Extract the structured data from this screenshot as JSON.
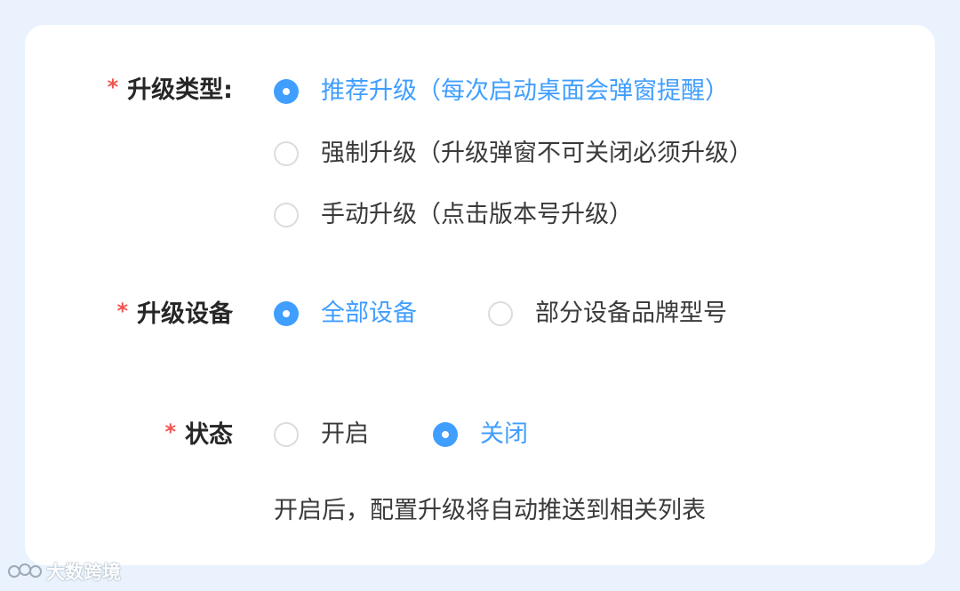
{
  "form": {
    "upgrade_type": {
      "required_mark": "*",
      "label": "升级类型:",
      "options": [
        {
          "text": "推荐升级（每次启动桌面会弹窗提醒）",
          "checked": true
        },
        {
          "text": "强制升级（升级弹窗不可关闭必须升级）",
          "checked": false
        },
        {
          "text": "手动升级（点击版本号升级）",
          "checked": false
        }
      ]
    },
    "upgrade_devices": {
      "required_mark": "*",
      "label": "升级设备",
      "options": [
        {
          "text": "全部设备",
          "checked": true
        },
        {
          "text": "部分设备品牌型号",
          "checked": false
        }
      ]
    },
    "status": {
      "required_mark": "*",
      "label": "状态",
      "options": [
        {
          "text": "开启",
          "checked": false
        },
        {
          "text": "关闭",
          "checked": true
        }
      ],
      "hint": "开启后，配置升级将自动推送到相关列表"
    }
  },
  "watermark": {
    "text": "大数跨境"
  },
  "colors": {
    "accent": "#409eff",
    "required": "#f0544f",
    "page_bg": "#e9f2fd",
    "card_bg": "#ffffff"
  }
}
